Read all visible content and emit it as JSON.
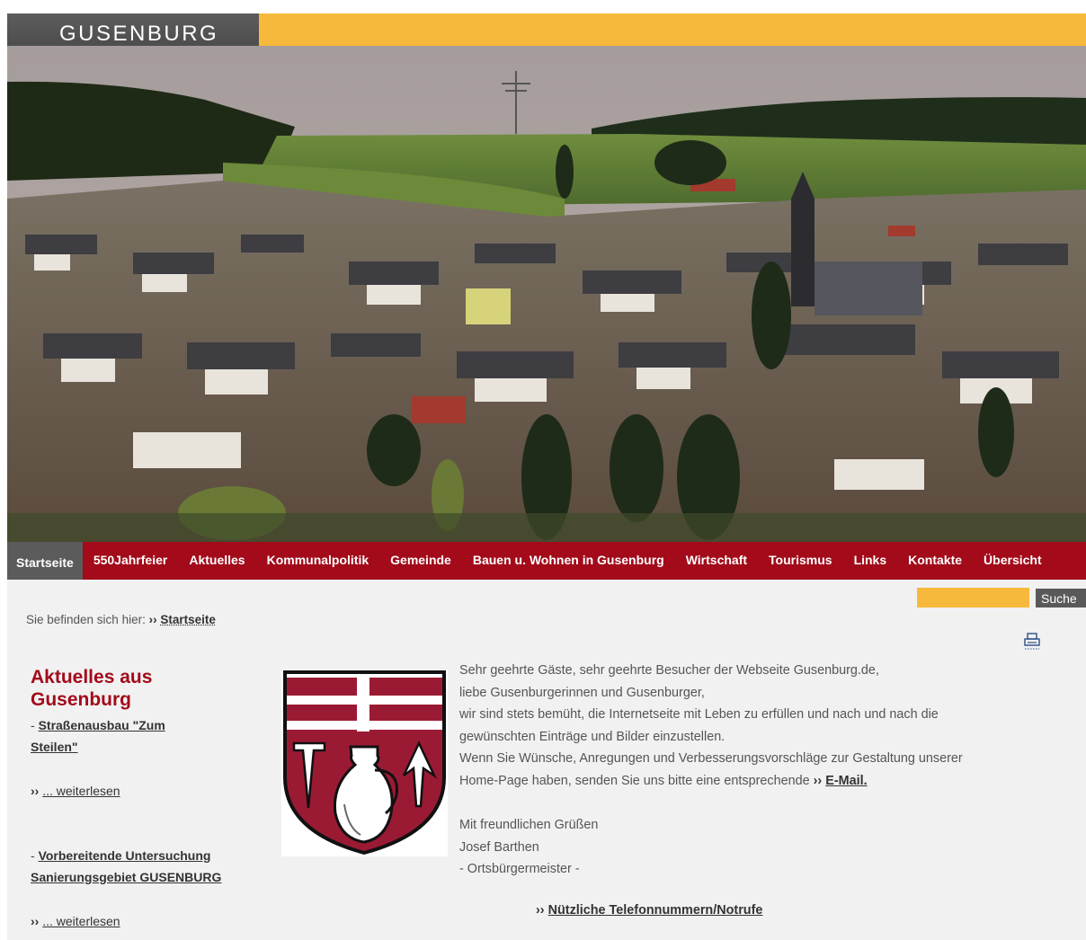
{
  "site": {
    "brand": "GUSENBURG",
    "colors": {
      "accent": "#f7b93b",
      "nav": "#a30a1a",
      "brand_bar": "#555555",
      "heading": "#a30a1a"
    }
  },
  "nav": {
    "items": [
      {
        "label": "Startseite",
        "active": true
      },
      {
        "label": "550Jahrfeier"
      },
      {
        "label": "Aktuelles"
      },
      {
        "label": "Kommunalpolitik"
      },
      {
        "label": "Gemeinde"
      },
      {
        "label": "Bauen u. Wohnen in Gusenburg"
      },
      {
        "label": "Wirtschaft"
      },
      {
        "label": "Tourismus"
      },
      {
        "label": "Links"
      },
      {
        "label": "Kontakte"
      },
      {
        "label": "Übersicht"
      }
    ]
  },
  "search": {
    "value": "",
    "button_label": "Suche"
  },
  "breadcrumb": {
    "prefix": "Sie befinden sich hier:",
    "separator": "››",
    "current": "Startseite"
  },
  "print": {
    "icon": "print-icon"
  },
  "sidebar": {
    "title": "Aktuelles aus Gusenburg",
    "news": [
      {
        "dash": "- ",
        "title": "Straßenausbau \"Zum Steilen\"",
        "more_prefix": "››",
        "more_label": "... weiterlesen"
      },
      {
        "dash": "- ",
        "title": "Vorbereitende Untersuchung Sanierungsgebiet GUSENBURG",
        "more_prefix": "››",
        "more_label": "... weiterlesen"
      }
    ]
  },
  "main": {
    "crest": "coat-of-arms",
    "greeting_lines": [
      "Sehr geehrte Gäste, sehr geehrte Besucher der Webseite Gusenburg.de,",
      "liebe Gusenburgerinnen und Gusenburger,",
      "wir sind stets bemüht, die Internetseite mit Leben zu erfüllen und nach und nach die",
      "gewünschten Einträge und Bilder einzustellen.",
      "Wenn Sie Wünsche, Anregungen und Verbesserungsvorschläge zur Gestaltung unserer"
    ],
    "email_prefix": "Home-Page haben, senden Sie uns bitte eine entsprechende",
    "email_chev": "››",
    "email_label": "E-Mail.",
    "closing": "Mit freundlichen Grüßen",
    "name": "Josef Barthen",
    "role": "- Ortsbürgermeister -",
    "phone_chev": "››",
    "phone_label": "Nützliche Telefonnummern/Notrufe"
  }
}
